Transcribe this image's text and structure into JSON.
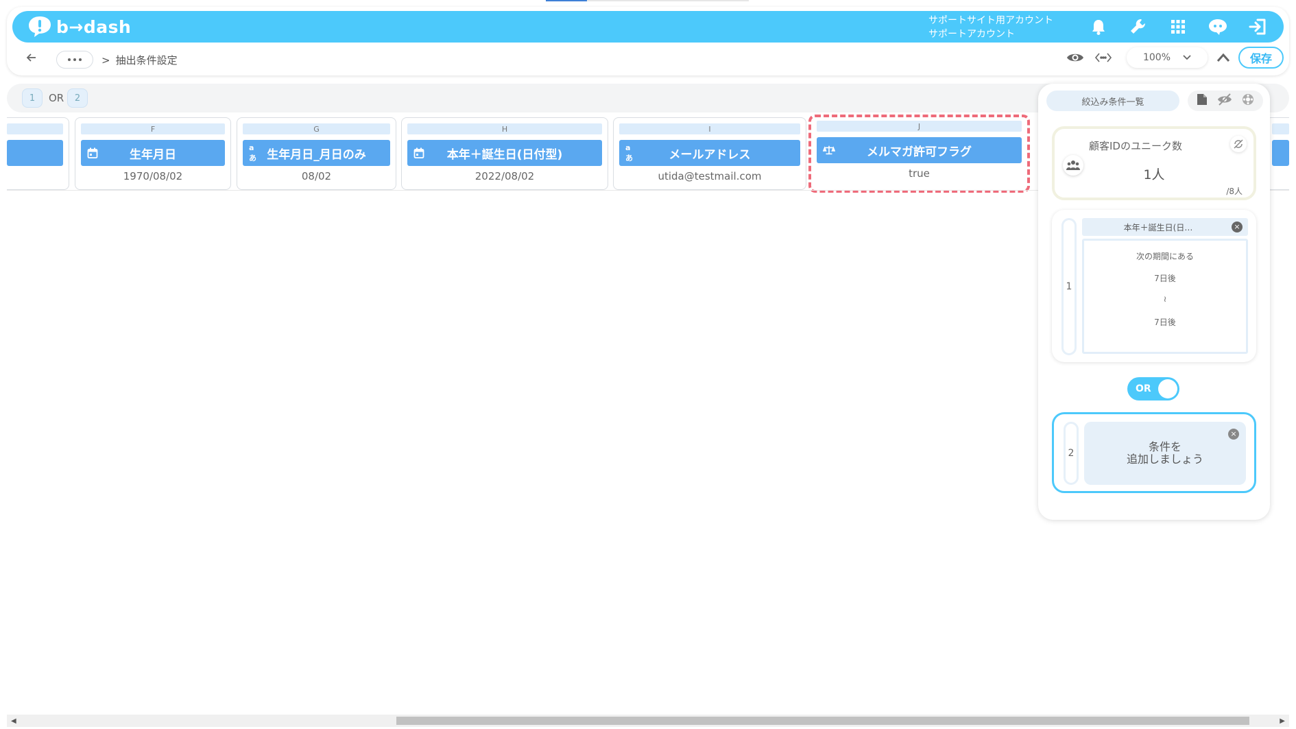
{
  "app": {
    "logo_text": "b→dash",
    "account_line1": "サポートサイト用アカウント",
    "account_line2": "サポートアカウント"
  },
  "header_icons": [
    "bell-icon",
    "wrench-icon",
    "apps-grid-icon",
    "support-chat-icon",
    "logout-icon"
  ],
  "breadcrumb": {
    "separator": ">",
    "current": "抽出条件設定"
  },
  "toolbar": {
    "zoom": "100%",
    "save_label": "保存"
  },
  "or_tabs": {
    "tab1": "1",
    "or": "OR",
    "tab2": "2"
  },
  "columns": [
    {
      "letter": "F",
      "name": "生年月日",
      "type": "date",
      "value": "1970/08/02"
    },
    {
      "letter": "G",
      "name": "生年月日_月日のみ",
      "type": "text",
      "type_glyph": "aあ",
      "value": "08/02"
    },
    {
      "letter": "H",
      "name": "本年＋誕生日(日付型)",
      "type": "date",
      "value": "2022/08/02"
    },
    {
      "letter": "I",
      "name": "メールアドレス",
      "type": "text",
      "type_glyph": "aあ",
      "value": "utida@testmail.com"
    },
    {
      "letter": "J",
      "name": "メルマガ許可フラグ",
      "type": "boolean",
      "value": "true"
    }
  ],
  "panel": {
    "title": "絞込み条件一覧",
    "count_title": "顧客IDのユニーク数",
    "count_value": "1人",
    "count_total": "/8人",
    "groups": [
      {
        "number": "1",
        "condition_title": "本年＋誕生日(日…",
        "lines": [
          "次の期間にある",
          "7日後",
          "≀",
          "7日後"
        ]
      },
      {
        "number": "2",
        "add_text_line1": "条件を",
        "add_text_line2": "追加しましょう"
      }
    ],
    "toggle_label": "OR"
  },
  "colors": {
    "brand": "#4cc9fb",
    "chip": "#5aa8f0",
    "highlight": "#ee6b7a"
  }
}
